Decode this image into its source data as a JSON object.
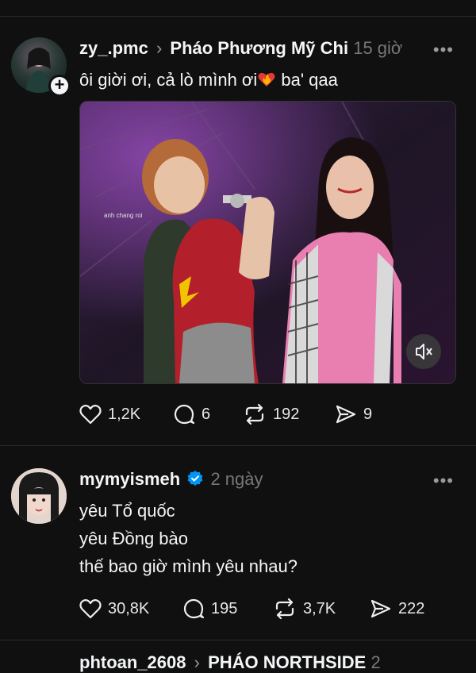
{
  "post1": {
    "username": "zy_.pmc",
    "reply_to": "Pháo Phương Mỹ Chi",
    "time": "15 giờ",
    "more": "•••",
    "text_before_emoji": "ôi giời ơi, cả lò mình ơi",
    "emoji": "heart-on-fire",
    "text_after_emoji": " ba' qaa",
    "likes": "1,2K",
    "comments": "6",
    "reposts": "192",
    "shares": "9",
    "media_caption": "anh chang roi"
  },
  "post2": {
    "username": "mymyismeh",
    "verified": true,
    "time": "2 ngày",
    "more": "•••",
    "lines": [
      "yêu Tổ quốc",
      "yêu Đồng bào",
      "thế bao giờ mình yêu nhau?"
    ],
    "likes": "30,8K",
    "comments": "195",
    "reposts": "3,7K",
    "shares": "222"
  },
  "post3": {
    "username_partial": "phtoan_2608",
    "reply_to_partial": "PHÁO NORTHSIDE",
    "time_partial": "2"
  },
  "colors": {
    "background": "#101010",
    "verified": "#0095f6",
    "text": "#f3f5f7",
    "muted": "#777777"
  }
}
